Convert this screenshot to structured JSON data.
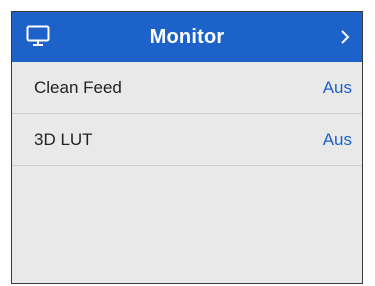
{
  "header": {
    "title": "Monitor",
    "icon": "monitor-icon",
    "chevron_icon": "chevron-right-icon",
    "background_color": "#1d62c9"
  },
  "settings": [
    {
      "label": "Clean Feed",
      "value": "Aus"
    },
    {
      "label": "3D LUT",
      "value": "Aus"
    }
  ],
  "colors": {
    "accent": "#1d62c9",
    "panel_background": "#e9e9e9",
    "text": "#222222"
  }
}
